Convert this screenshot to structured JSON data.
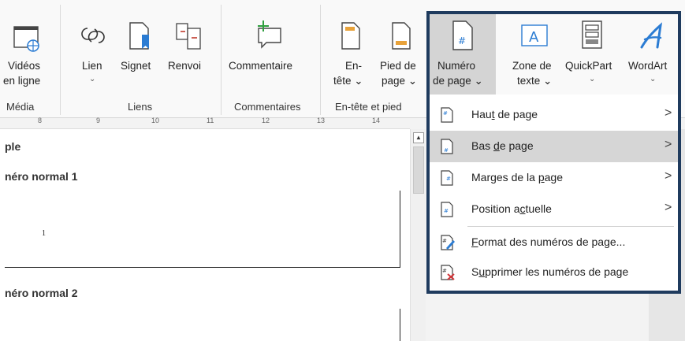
{
  "ribbon": {
    "media": {
      "label1": "Vidéos",
      "label2": "en ligne",
      "group": "Média"
    },
    "links": {
      "lien_label": "Lien",
      "lien_chev": "⌄",
      "signet_label": "Signet",
      "renvoi_label": "Renvoi",
      "group": "Liens"
    },
    "comments": {
      "label": "Commentaire",
      "group": "Commentaires"
    },
    "header_footer": {
      "en_tete_1": "En-",
      "en_tete_2": "tête ⌄",
      "pied_1": "Pied de",
      "pied_2": "page ⌄",
      "numero_1": "Numéro",
      "numero_2": "de page ⌄",
      "group": "En-tête et pied"
    },
    "text": {
      "zone_1": "Zone de",
      "zone_2": "texte ⌄",
      "quickpart": "QuickPart",
      "quickpart_chev": "⌄",
      "wordart": "WordArt",
      "wordart_chev": "⌄"
    }
  },
  "ruler": {
    "ticks": [
      "8",
      "9",
      "10",
      "11",
      "12",
      "13",
      "14"
    ]
  },
  "document": {
    "heading": "ple",
    "section1": "néro normal 1",
    "page_number": "1",
    "section2": "néro normal 2"
  },
  "menu": {
    "items": [
      {
        "pre": "Hau",
        "key": "t",
        "post": " de page",
        "has_arrow": true
      },
      {
        "pre": "Bas ",
        "key": "d",
        "post": "e page",
        "has_arrow": true
      },
      {
        "pre": "Marges de la ",
        "key": "p",
        "post": "age",
        "has_arrow": true
      },
      {
        "pre": "Position a",
        "key": "c",
        "post": "tuelle",
        "has_arrow": true
      },
      {
        "pre": "",
        "key": "F",
        "post": "ormat des numéros de page...",
        "has_arrow": false
      },
      {
        "pre": "S",
        "key": "u",
        "post": "pprimer les numéros de page",
        "has_arrow": false
      }
    ],
    "arrow": ">"
  },
  "colors": {
    "highlight_border": "#1f3b5e",
    "accent_blue": "#2b7cd3",
    "selected_bg": "#d6d6d6",
    "comment_green": "#2e9e3e"
  }
}
